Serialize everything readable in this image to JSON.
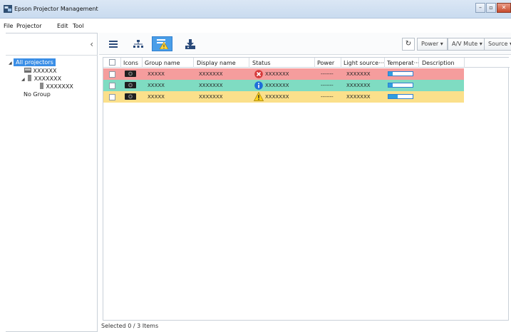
{
  "window": {
    "title": "Epson Projector Management"
  },
  "menu": [
    {
      "label": "File"
    },
    {
      "label": "Projector"
    },
    {
      "label": "Edit"
    },
    {
      "label": "Tool"
    }
  ],
  "tree": {
    "root": "All projectors",
    "group1": "XXXXXX",
    "group2": "XXXXXXX",
    "group2_child": "XXXXXXX",
    "nogroup": "No Group"
  },
  "toolbar": {
    "power_label": "Power",
    "avmute_label": "A/V Mute",
    "source_label": "Source"
  },
  "table": {
    "columns": [
      "Icons",
      "Group name",
      "Display name",
      "Status",
      "Power",
      "Light source···",
      "Temperat···",
      "Description"
    ],
    "rows": [
      {
        "group": "XXXXX",
        "display": "XXXXXXX",
        "status": "XXXXXXX",
        "status_icon": "error-icon",
        "power": "-------",
        "light": "XXXXXXX",
        "temp_level": 0.18,
        "color": "#f59d9d"
      },
      {
        "group": "XXXXX",
        "display": "XXXXXXX",
        "status": "XXXXXXX",
        "status_icon": "info-icon",
        "power": "-------",
        "light": "XXXXXXX",
        "temp_level": 0.18,
        "color": "#7fdcc2"
      },
      {
        "group": "XXXXX",
        "display": "XXXXXXX",
        "status": "XXXXXXX",
        "status_icon": "warning-icon",
        "power": "-------",
        "light": "XXXXXXX",
        "temp_level": 0.38,
        "color": "#fbe08b"
      }
    ]
  },
  "statusbar": {
    "text": "Selected  0 / 3  Items"
  }
}
